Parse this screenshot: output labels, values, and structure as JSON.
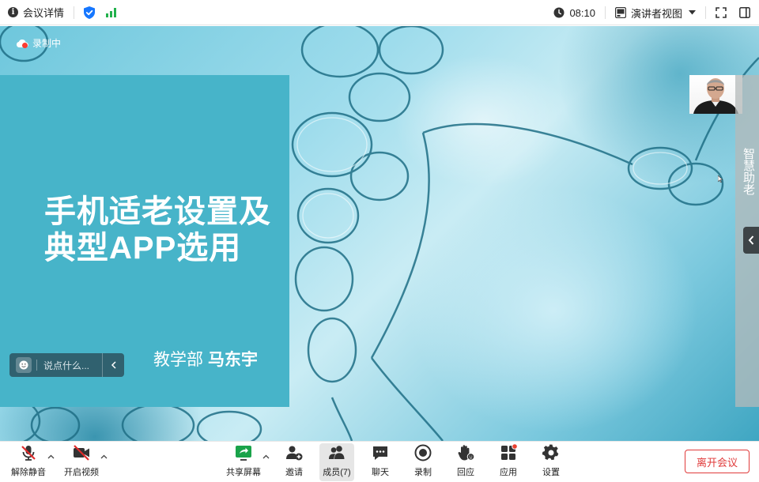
{
  "topbar": {
    "meeting_details_label": "会议详情",
    "time": "08:10",
    "view_label": "演讲者视图"
  },
  "stage": {
    "recording_label": "录制中"
  },
  "slide": {
    "title": "手机适老设置及典型APP选用",
    "author_dept": "教学部",
    "author_name": "马东宇"
  },
  "chat": {
    "placeholder": "说点什么..."
  },
  "side_panel": {
    "label": "智慧助老"
  },
  "toolbar": {
    "unmute": "解除静音",
    "start_video": "开启视频",
    "share_screen": "共享屏幕",
    "invite": "邀请",
    "members": "成员(7)",
    "chat": "聊天",
    "record": "录制",
    "react": "回应",
    "apps": "应用",
    "settings": "设置",
    "leave": "离开会议"
  },
  "colors": {
    "accent_green": "#22b14c",
    "slide_bg": "#47b4c9",
    "leave_red": "#e03a3a",
    "mute_red": "#e02b2b"
  }
}
